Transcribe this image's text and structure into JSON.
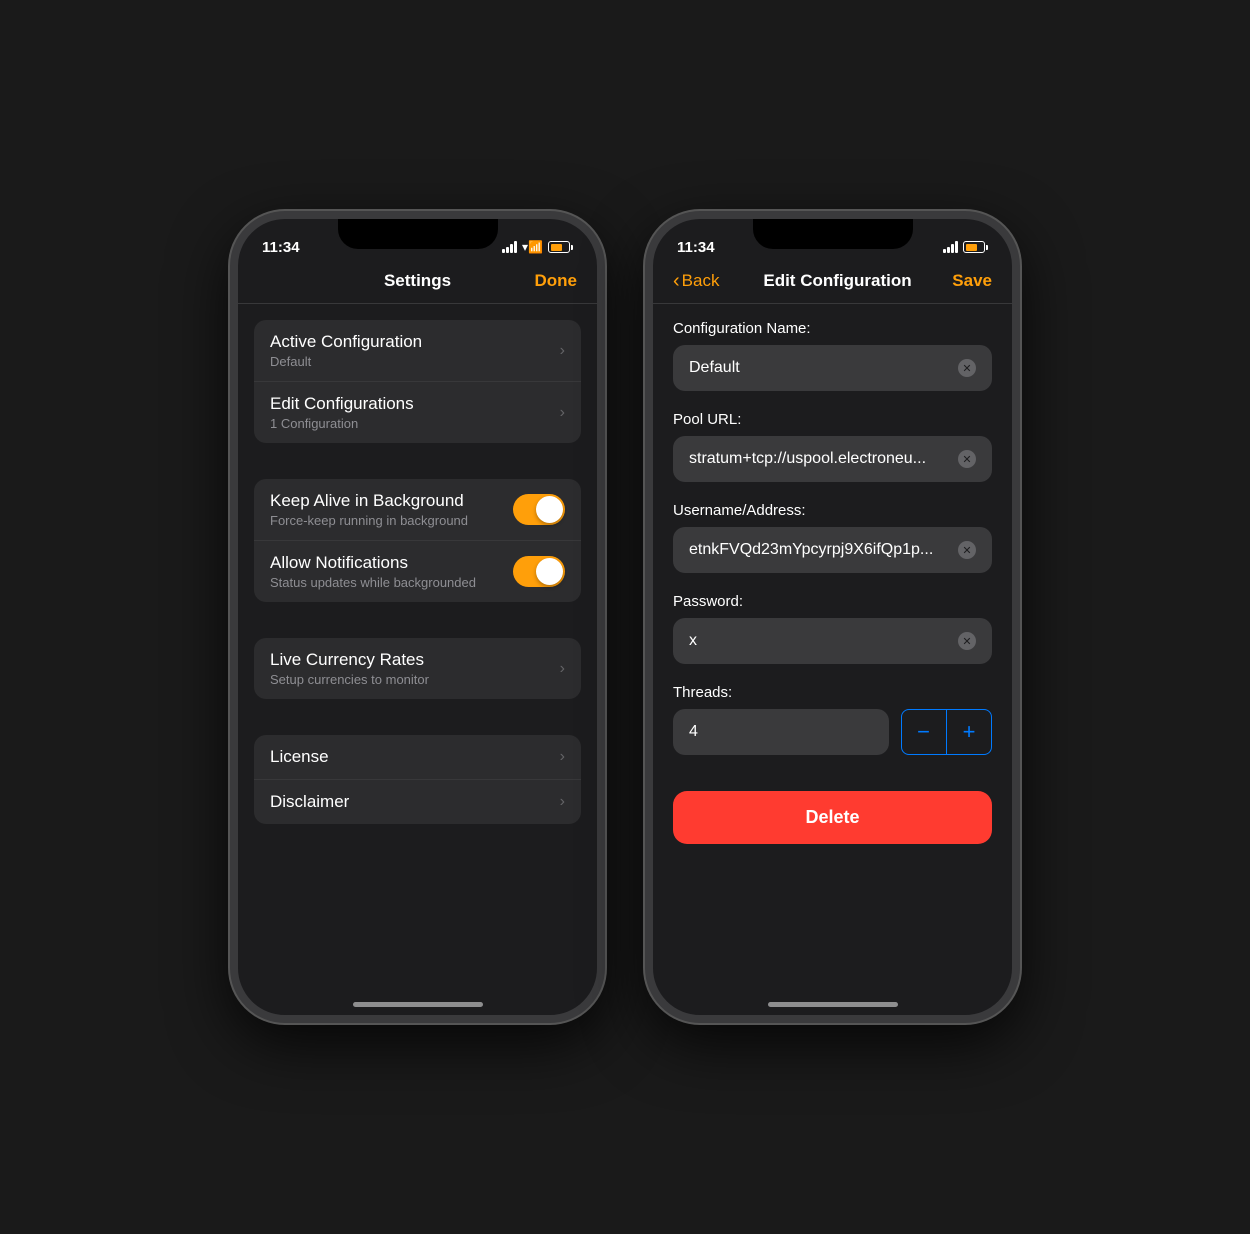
{
  "left_phone": {
    "status": {
      "time": "11:34"
    },
    "nav": {
      "title": "Settings",
      "done_label": "Done"
    },
    "rows": [
      {
        "title": "Active Configuration",
        "subtitle": "Default",
        "type": "nav"
      },
      {
        "title": "Edit Configurations",
        "subtitle": "1 Configuration",
        "type": "nav"
      }
    ],
    "toggles": [
      {
        "title": "Keep Alive in Background",
        "subtitle": "Force-keep running in background",
        "enabled": true
      },
      {
        "title": "Allow Notifications",
        "subtitle": "Status updates while backgrounded",
        "enabled": true
      }
    ],
    "bottom_rows": [
      {
        "title": "Live Currency Rates",
        "subtitle": "Setup currencies to monitor",
        "type": "nav"
      },
      {
        "title": "License",
        "subtitle": "",
        "type": "nav"
      },
      {
        "title": "Disclaimer",
        "subtitle": "",
        "type": "nav"
      }
    ]
  },
  "right_phone": {
    "status": {
      "time": "11:34"
    },
    "nav": {
      "back_label": "Back",
      "title": "Edit Configuration",
      "save_label": "Save"
    },
    "form": {
      "config_name_label": "Configuration Name:",
      "config_name_value": "Default",
      "pool_url_label": "Pool URL:",
      "pool_url_value": "stratum+tcp://uspool.electroneu...",
      "username_label": "Username/Address:",
      "username_value": "etnkFVQd23mYpcyrpj9X6ifQp1p...",
      "password_label": "Password:",
      "password_value": "x",
      "threads_label": "Threads:",
      "threads_value": "4",
      "decrement_label": "−",
      "increment_label": "+",
      "delete_label": "Delete"
    }
  }
}
